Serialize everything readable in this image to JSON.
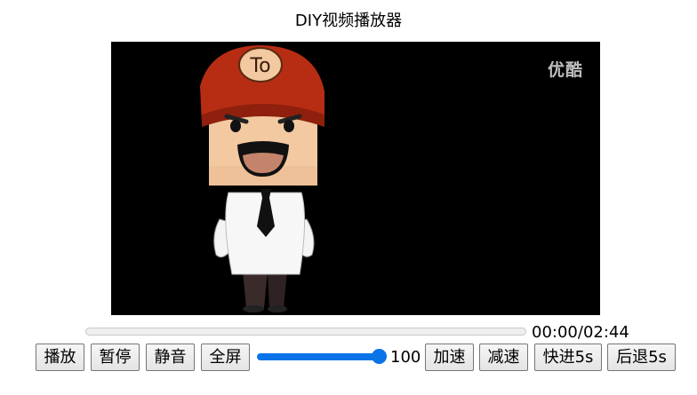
{
  "page": {
    "title": "DIY视频播放器"
  },
  "video": {
    "watermark": "优酷",
    "cap_logo": "To",
    "current_time": "00:00",
    "duration": "02:44",
    "time_display": "00:00/02:44",
    "progress": 0
  },
  "controls": {
    "play_label": "播放",
    "pause_label": "暂停",
    "mute_label": "静音",
    "fullscreen_label": "全屏",
    "volume_value": "100",
    "volume_level": 1.0,
    "speed_up_label": "加速",
    "slow_down_label": "减速",
    "forward_label": "快进5s",
    "rewind_label": "后退5s"
  },
  "colors": {
    "accent": "#0a73e8",
    "video_background": "#000000",
    "cap_red": "#b72d14"
  }
}
